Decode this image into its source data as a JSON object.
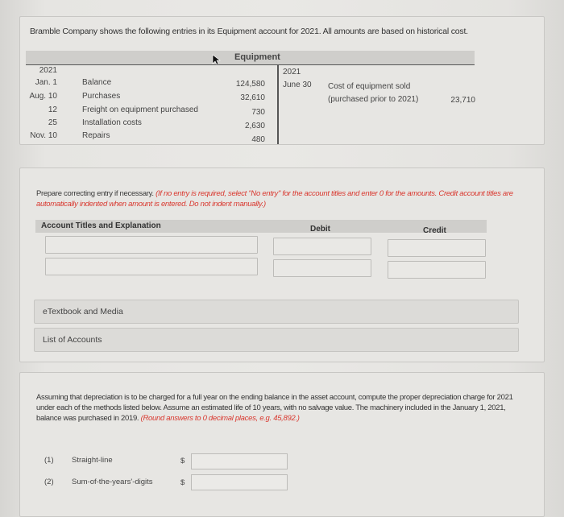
{
  "problem": {
    "intro": "Bramble Company shows the following entries in its Equipment account for 2021. All amounts are based on historical cost."
  },
  "t_account": {
    "title": "Equipment",
    "debit_side": {
      "year": "2021",
      "entries": [
        {
          "date": "Jan. 1",
          "description": "Balance",
          "amount": "124,580"
        },
        {
          "date": "Aug. 10",
          "description": "Purchases",
          "amount": "32,610"
        },
        {
          "date": "12",
          "description": "Freight on equipment purchased",
          "amount": "730"
        },
        {
          "date": "25",
          "description": "Installation costs",
          "amount": "2,630"
        },
        {
          "date": "Nov. 10",
          "description": "Repairs",
          "amount": "480"
        }
      ]
    },
    "credit_side": {
      "year": "2021",
      "entries": [
        {
          "date": "June 30",
          "description_line1": "Cost of equipment sold",
          "description_line2": "(purchased prior to 2021)",
          "amount": "23,710"
        }
      ]
    }
  },
  "journal": {
    "instruction": "Prepare correcting entry if necessary.",
    "instruction_note": "(If no entry is required, select \"No entry\" for the account titles and enter 0 for the amounts. Credit account titles are automatically indented when amount is entered. Do not indent manually.)",
    "columns": {
      "account": "Account Titles and Explanation",
      "debit": "Debit",
      "credit": "Credit"
    },
    "rows": [
      {
        "account": "",
        "debit": "",
        "credit": ""
      },
      {
        "account": "",
        "debit": "",
        "credit": ""
      }
    ]
  },
  "links": {
    "etextbook": "eTextbook and Media",
    "list_of_accounts": "List of Accounts"
  },
  "depreciation": {
    "question": "Assuming that depreciation is to be charged for a full year on the ending balance in the asset account, compute the proper depreciation charge for 2021 under each of the methods listed below. Assume an estimated life of 10 years, with no salvage value. The machinery included in the January 1, 2021, balance was purchased in 2019.",
    "note": "(Round answers to 0 decimal places, e.g. 45,892.)",
    "currency": "$",
    "methods": [
      {
        "num": "(1)",
        "name": "Straight-line",
        "value": ""
      },
      {
        "num": "(2)",
        "name": "Sum-of-the-years'-digits",
        "value": ""
      }
    ]
  },
  "colors": {
    "instruction_red": "#d9382f",
    "panel_bg": "#e7e6e3",
    "header_bg": "#cfcecb"
  }
}
